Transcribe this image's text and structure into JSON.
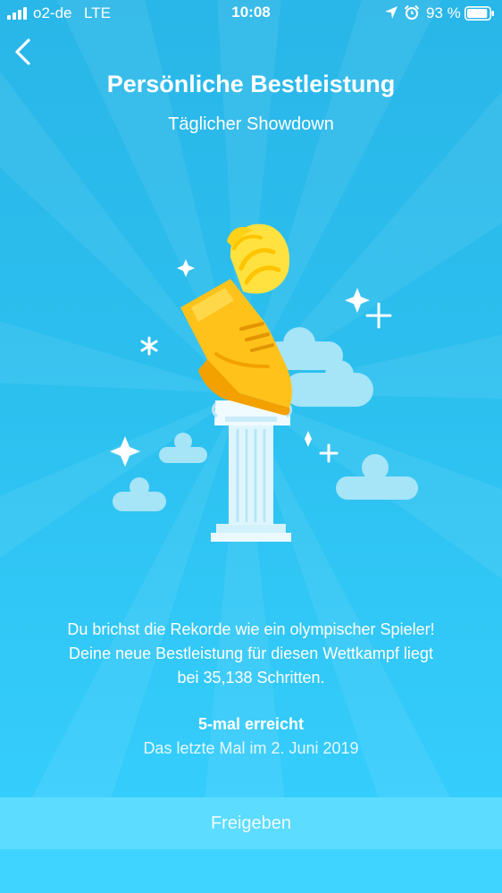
{
  "status_bar": {
    "carrier": "o2-de",
    "network": "LTE",
    "time": "10:08",
    "battery": "93 %",
    "battery_level": 0.93,
    "icons": [
      "signal-icon",
      "location-arrow-icon",
      "alarm-icon",
      "battery-icon"
    ]
  },
  "header": {
    "back_icon": "chevron-left-icon",
    "title": "Persönliche Bestleistung",
    "subtitle": "Täglicher Showdown"
  },
  "illustration": {
    "name": "winged-shoe-on-column",
    "colors": {
      "background_top": "#29b6e8",
      "background_bottom": "#37d0ff",
      "shoe": "#ffc21a",
      "shoe_shadow": "#f2a100",
      "wing": "#ffe23f",
      "column": "#eaf9ff",
      "cloud": "#a6e4f7"
    }
  },
  "message": {
    "line1": "Du brichst die Rekorde wie ein olympischer Spieler!",
    "line2": "Deine neue Bestleistung für diesen Wettkampf liegt",
    "line3": "bei 35,138 Schritten."
  },
  "achievement": {
    "count_label": "5-mal erreicht",
    "last_time": "Das letzte Mal im 2. Juni 2019"
  },
  "actions": {
    "share_label": "Freigeben"
  }
}
